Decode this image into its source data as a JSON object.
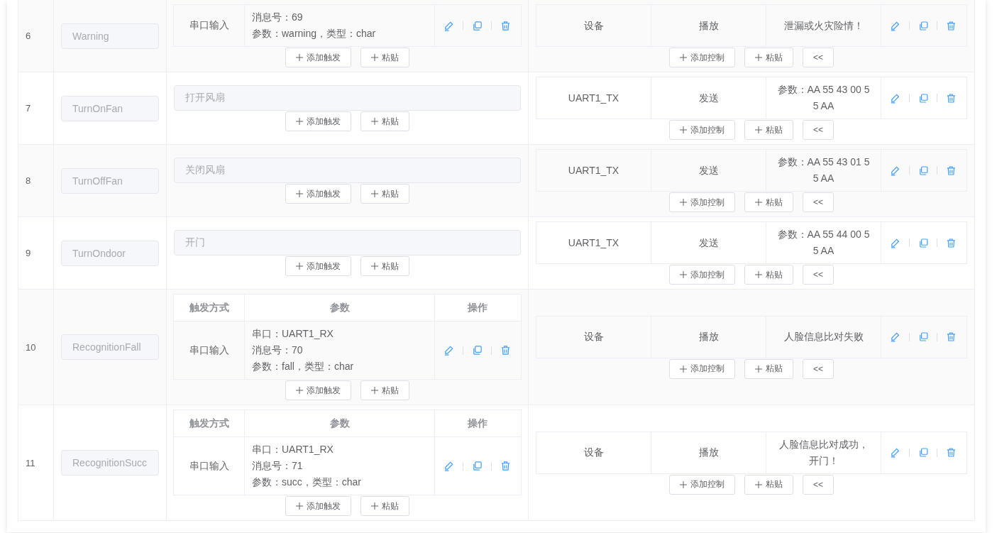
{
  "rows": [
    {
      "index": "6",
      "name": {
        "value": "Warning",
        "disabled": true
      },
      "trigger": {
        "kind": "table",
        "rows": [
          {
            "method": "串口输入",
            "params": [
              "消息号：69",
              "参数：warning，类型：char"
            ]
          }
        ]
      },
      "trigger_buttons": [
        "添加触发",
        "粘贴"
      ],
      "controls": [
        {
          "device": "设备",
          "action": "播放",
          "params": "泄漏或火灾险情！"
        }
      ],
      "control_buttons": [
        "添加控制",
        "粘贴",
        "<<"
      ]
    },
    {
      "index": "7",
      "name": {
        "value": "TurnOnFan",
        "disabled": true
      },
      "trigger": {
        "kind": "input",
        "value": "打开风扇",
        "disabled": true
      },
      "trigger_buttons": [
        "添加触发",
        "粘贴"
      ],
      "controls": [
        {
          "device": "UART1_TX",
          "action": "发送",
          "params": "参数：AA 55 43 00 55 AA"
        }
      ],
      "control_buttons": [
        "添加控制",
        "粘贴",
        "<<"
      ]
    },
    {
      "index": "8",
      "name": {
        "value": "TurnOffFan",
        "disabled": true
      },
      "trigger": {
        "kind": "input",
        "value": "关闭风扇",
        "disabled": true
      },
      "trigger_buttons": [
        "添加触发",
        "粘贴"
      ],
      "controls": [
        {
          "device": "UART1_TX",
          "action": "发送",
          "params": "参数：AA 55 43 01 55 AA"
        }
      ],
      "control_buttons": [
        "添加控制",
        "粘贴",
        "<<"
      ]
    },
    {
      "index": "9",
      "name": {
        "value": "TurnOndoor",
        "disabled": true
      },
      "trigger": {
        "kind": "input",
        "value": "开门",
        "disabled": true
      },
      "trigger_buttons": [
        "添加触发",
        "粘贴"
      ],
      "controls": [
        {
          "device": "UART1_TX",
          "action": "发送",
          "params": "参数：AA 55 44 00 55 AA"
        }
      ],
      "control_buttons": [
        "添加控制",
        "粘贴",
        "<<"
      ]
    },
    {
      "index": "10",
      "name": {
        "value": "RecognitionFall",
        "disabled": true
      },
      "trigger": {
        "kind": "table",
        "headers": [
          "触发方式",
          "参数",
          "操作"
        ],
        "rows": [
          {
            "method": "串口输入",
            "params": [
              "串口：UART1_RX",
              "消息号：70",
              "参数：fall，类型：char"
            ]
          }
        ]
      },
      "trigger_buttons": [
        "添加触发",
        "粘贴"
      ],
      "controls": [
        {
          "device": "设备",
          "action": "播放",
          "params": "人脸信息比对失败"
        }
      ],
      "control_buttons": [
        "添加控制",
        "粘贴",
        "<<"
      ]
    },
    {
      "index": "11",
      "name": {
        "value": "RecognitionSucc",
        "disabled": true
      },
      "trigger": {
        "kind": "table",
        "headers": [
          "触发方式",
          "参数",
          "操作"
        ],
        "rows": [
          {
            "method": "串口输入",
            "params": [
              "串口：UART1_RX",
              "消息号：71",
              "参数：succ，类型：char"
            ]
          }
        ]
      },
      "trigger_buttons": [
        "添加触发",
        "粘贴"
      ],
      "controls": [
        {
          "device": "设备",
          "action": "播放",
          "params": "人脸信息比对成功，开门！"
        }
      ],
      "control_buttons": [
        "添加控制",
        "粘贴",
        "<<"
      ]
    }
  ]
}
